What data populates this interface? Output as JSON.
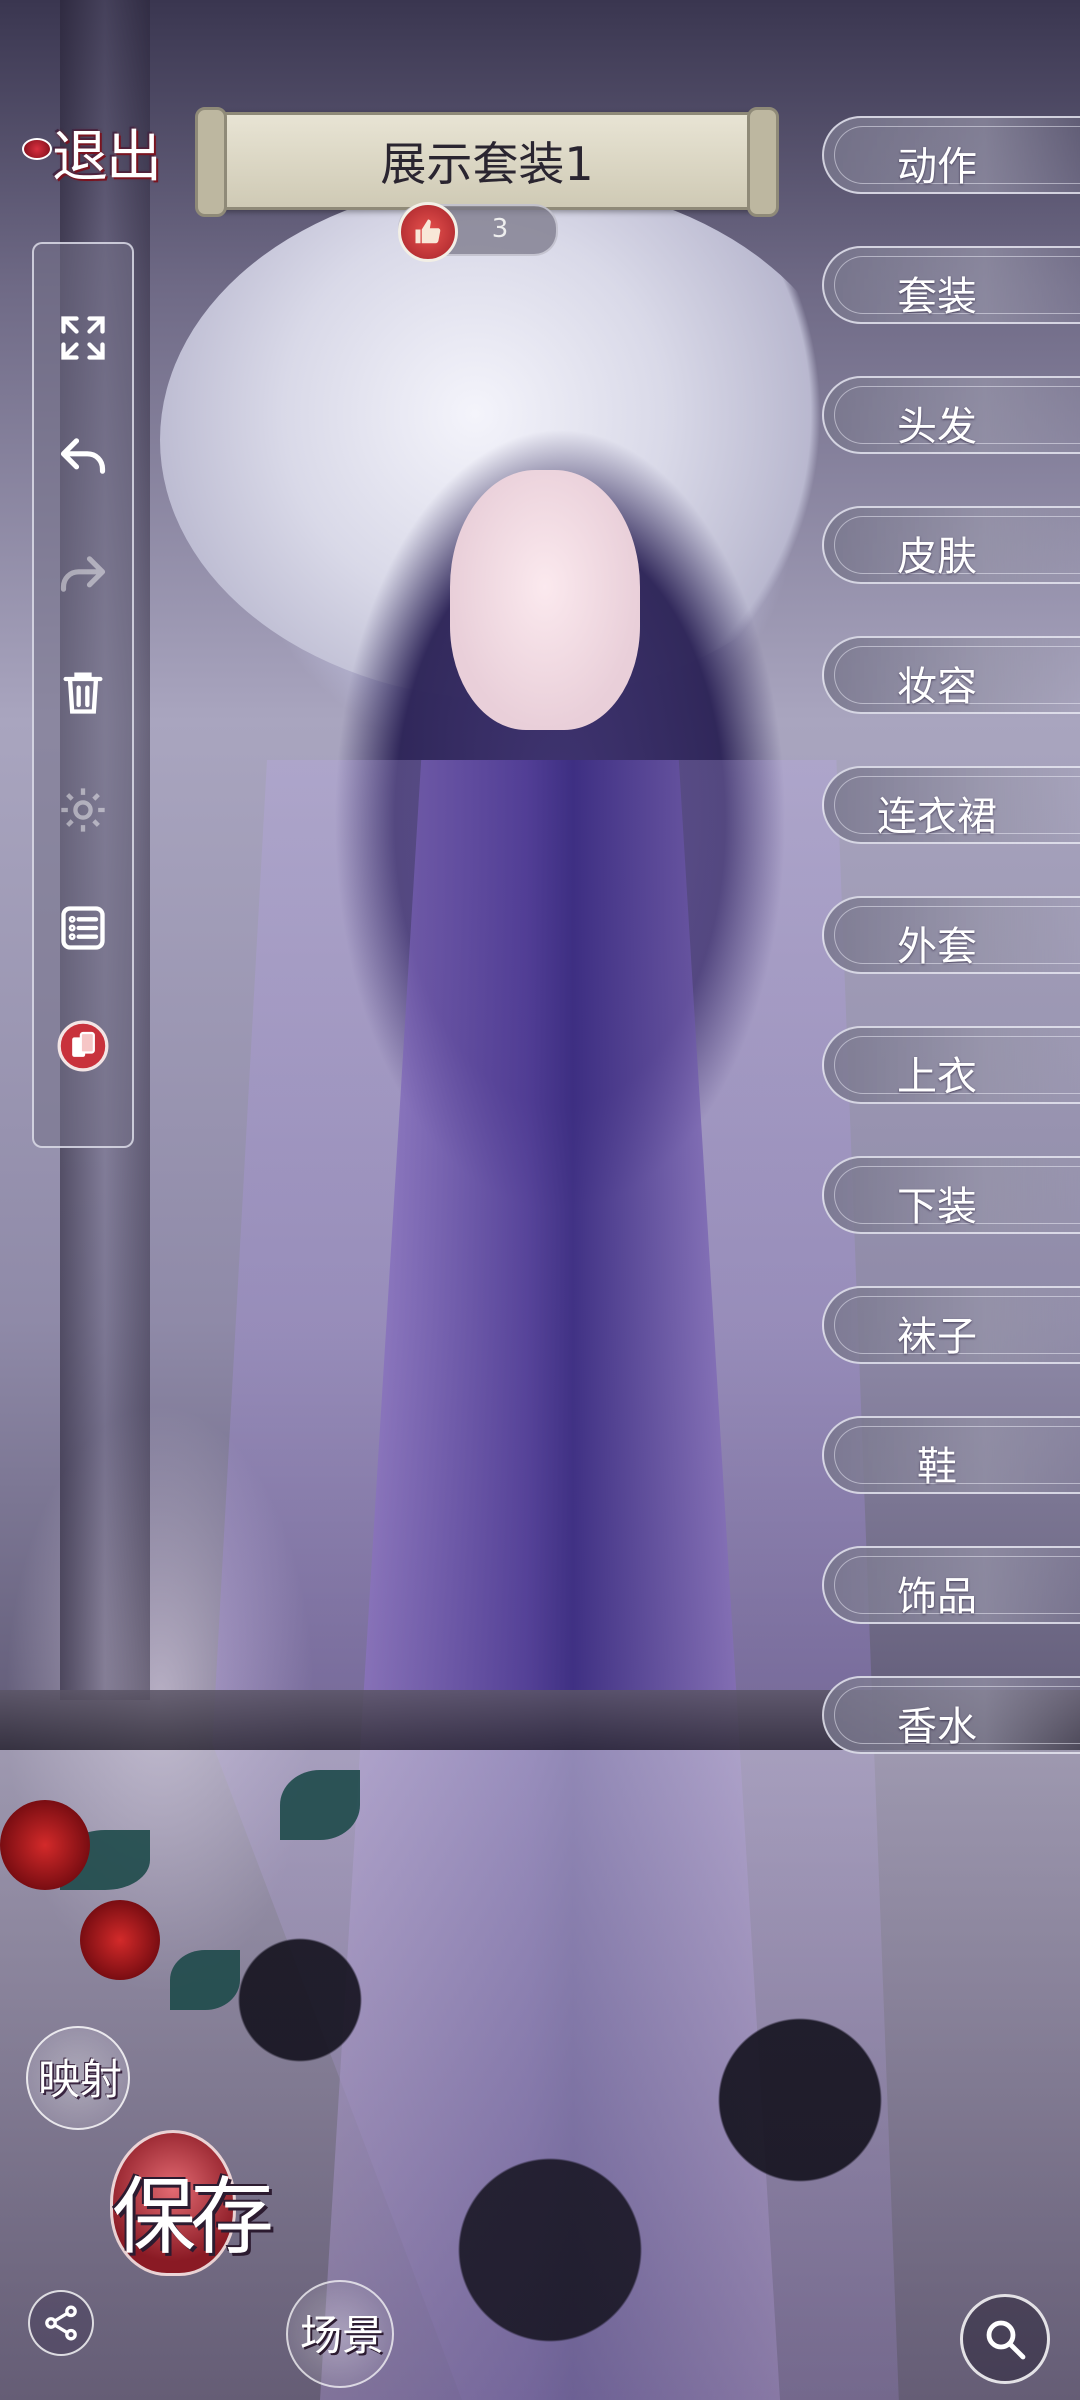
{
  "header": {
    "exit_label": "退出",
    "outfit_title": "展示套装1",
    "likes_count": "3"
  },
  "toolbar": {
    "tools": [
      {
        "icon": "fullscreen-icon"
      },
      {
        "icon": "undo-icon"
      },
      {
        "icon": "redo-icon"
      },
      {
        "icon": "trash-icon"
      },
      {
        "icon": "settings-icon"
      },
      {
        "icon": "list-icon"
      },
      {
        "icon": "card-switch-icon"
      }
    ]
  },
  "menu": {
    "items": [
      {
        "label": "动作"
      },
      {
        "label": "套装"
      },
      {
        "label": "头发"
      },
      {
        "label": "皮肤"
      },
      {
        "label": "妆容"
      },
      {
        "label": "连衣裙"
      },
      {
        "label": "外套"
      },
      {
        "label": "上衣"
      },
      {
        "label": "下装"
      },
      {
        "label": "袜子"
      },
      {
        "label": "鞋"
      },
      {
        "label": "饰品"
      },
      {
        "label": "香水"
      }
    ]
  },
  "bottom": {
    "mapping_label": "映射",
    "save_label": "保存",
    "scene_label": "场景",
    "share_icon": "share-icon",
    "search_icon": "search-icon"
  },
  "colors": {
    "accent_red": "#c8323c",
    "panel_border": "#ebebf5"
  }
}
